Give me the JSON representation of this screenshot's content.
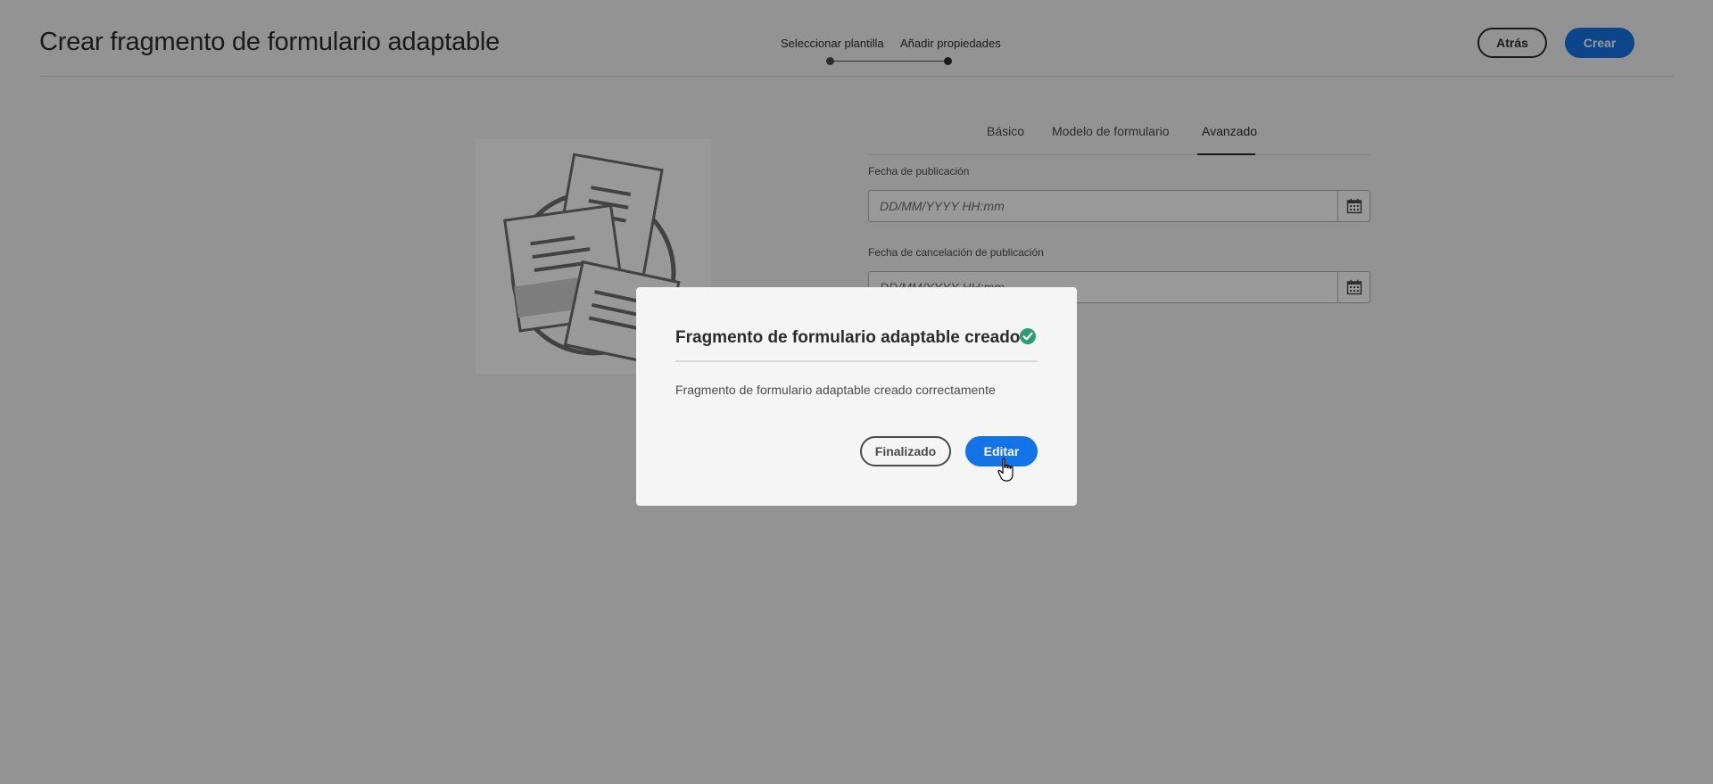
{
  "header": {
    "title": "Crear fragmento de formulario adaptable",
    "steps": [
      "Seleccionar plantilla",
      "Añadir propiedades"
    ],
    "back_label": "Atrás",
    "create_label": "Crear"
  },
  "tabs": [
    {
      "label": "Básico"
    },
    {
      "label": "Modelo de formulario"
    },
    {
      "label": "Avanzado",
      "active": true
    }
  ],
  "form": {
    "publish_label": "Fecha de publicación",
    "publish_placeholder": "DD/MM/YYYY HH:mm",
    "unpublish_label": "Fecha de cancelación de publicación",
    "unpublish_placeholder": "DD/MM/YYYY HH:mm",
    "calendar_icon": "calendar-icon"
  },
  "dialog": {
    "title": "Fragmento de formulario adaptable creado",
    "body": "Fragmento de formulario adaptable creado correctamente",
    "done_label": "Finalizado",
    "edit_label": "Editar",
    "status_icon": "check-circle-icon"
  },
  "colors": {
    "accent": "#1473e6",
    "success": "#2d9d78",
    "overlay": "rgba(0,0,0,0.4)"
  }
}
